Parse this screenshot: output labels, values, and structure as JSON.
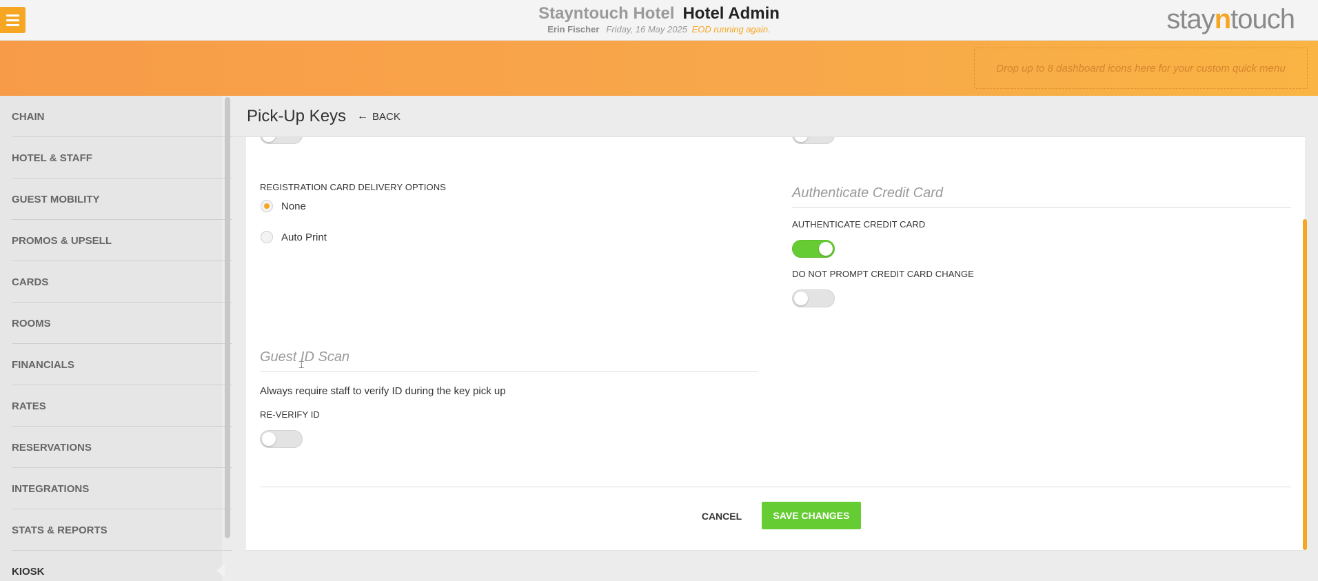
{
  "header": {
    "hotel_name": "Stayntouch Hotel",
    "app_name": "Hotel Admin",
    "user_name": "Erin Fischer",
    "date": "Friday, 16 May 2025",
    "eod_status": "EOD running again.",
    "logo_left": "stay",
    "logo_mid": "n",
    "logo_right": "touch"
  },
  "quick_menu": {
    "placeholder": "Drop up to 8 dashboard icons here for your custom quick menu"
  },
  "sidebar": {
    "items": [
      {
        "label": "CHAIN"
      },
      {
        "label": "HOTEL & STAFF"
      },
      {
        "label": "GUEST MOBILITY"
      },
      {
        "label": "PROMOS & UPSELL"
      },
      {
        "label": "CARDS"
      },
      {
        "label": "ROOMS"
      },
      {
        "label": "FINANCIALS"
      },
      {
        "label": "RATES"
      },
      {
        "label": "RESERVATIONS"
      },
      {
        "label": "INTEGRATIONS"
      },
      {
        "label": "STATS & REPORTS"
      },
      {
        "label": "KIOSK"
      }
    ],
    "active": "KIOSK"
  },
  "page": {
    "title": "Pick-Up Keys",
    "back_label": "BACK"
  },
  "registration": {
    "label": "REGISTRATION CARD DELIVERY OPTIONS",
    "options": [
      {
        "label": "None",
        "selected": true
      },
      {
        "label": "Auto Print",
        "selected": false
      }
    ]
  },
  "authenticate": {
    "section_title": "Authenticate Credit Card",
    "auth_label": "AUTHENTICATE CREDIT CARD",
    "auth_on": true,
    "no_prompt_label": "DO NOT PROMPT CREDIT CARD CHANGE",
    "no_prompt_on": false
  },
  "guest_id": {
    "section_title": "Guest ID Scan",
    "description": "Always require staff to verify ID during the key pick up",
    "reverify_label": "RE-VERIFY ID",
    "reverify_on": false
  },
  "actions": {
    "cancel": "CANCEL",
    "save": "SAVE CHANGES"
  },
  "colors": {
    "accent": "#f6a623",
    "toggle_on": "#66cc33",
    "save_button": "#66cc33"
  }
}
